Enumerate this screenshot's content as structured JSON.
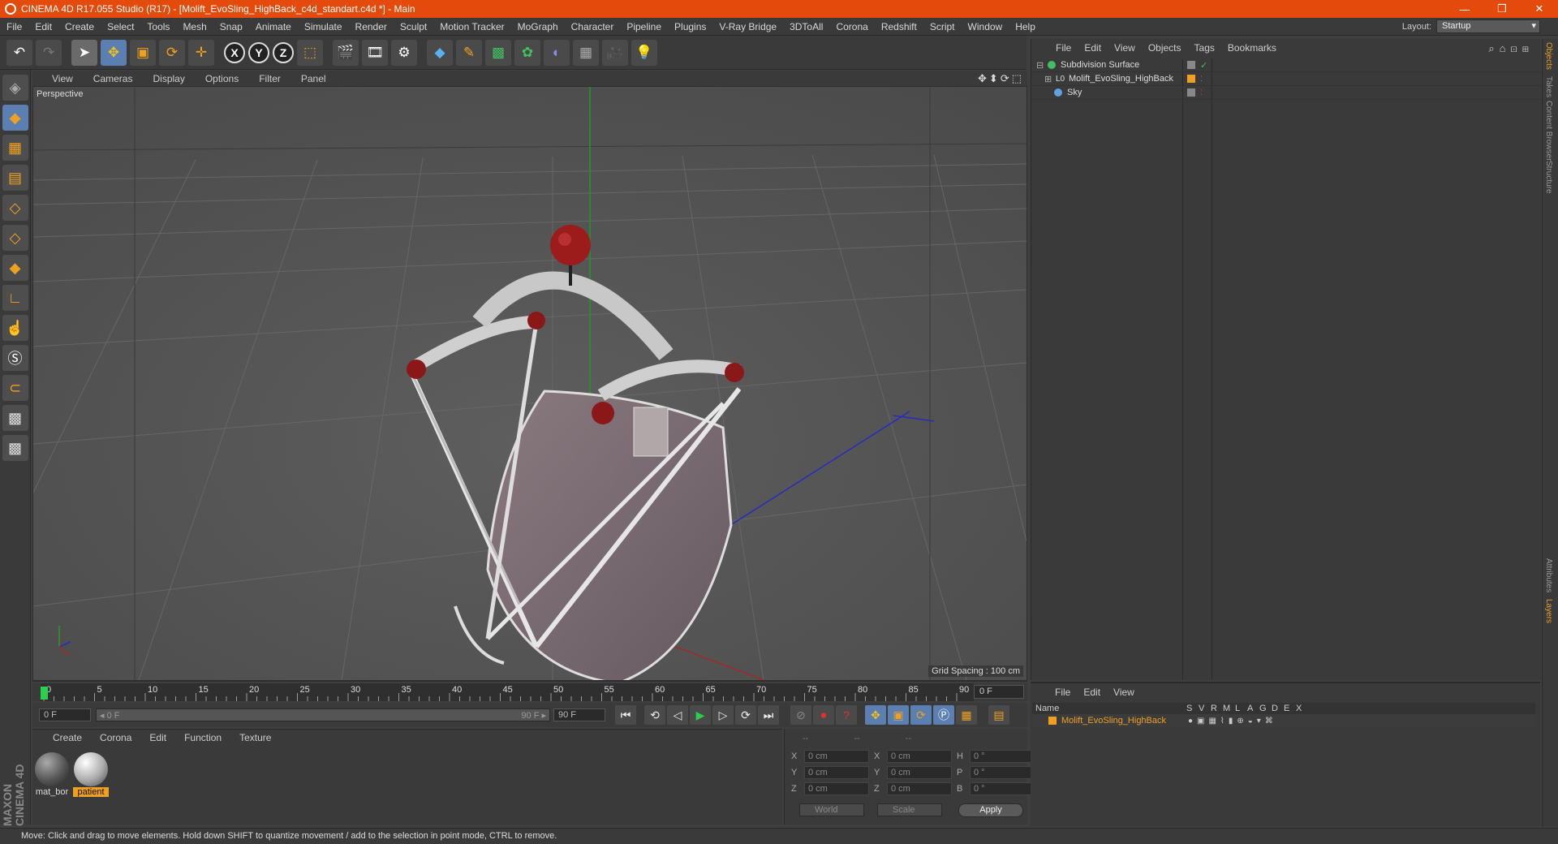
{
  "window": {
    "title": "CINEMA 4D R17.055 Studio (R17) - [Molift_EvoSling_HighBack_c4d_standart.c4d *] - Main",
    "minimize": "—",
    "maximize": "❐",
    "close": "✕"
  },
  "menu": [
    "File",
    "Edit",
    "Create",
    "Select",
    "Tools",
    "Mesh",
    "Snap",
    "Animate",
    "Simulate",
    "Render",
    "Sculpt",
    "Motion Tracker",
    "MoGraph",
    "Character",
    "Pipeline",
    "Plugins",
    "V-Ray Bridge",
    "3DToAll",
    "Corona",
    "Redshift",
    "Script",
    "Window",
    "Help"
  ],
  "layout": {
    "label": "Layout:",
    "value": "Startup"
  },
  "toolbar": {
    "undo": "↶",
    "redo": "↷",
    "select": "➤",
    "move": "✥",
    "scale": "▣",
    "rotate": "⟳",
    "transform": "✛",
    "x": "X",
    "y": "Y",
    "z": "Z",
    "coord": "⬚",
    "render_view": "🎬",
    "render": "🎞",
    "render_settings": "⚙",
    "cube": "◆",
    "pen": "✎",
    "subdivide": "▩",
    "mograph": "✿",
    "deformer": "◐",
    "floor": "▦",
    "camera": "🎥",
    "light": "💡"
  },
  "viewport": {
    "menu": [
      "View",
      "Cameras",
      "Display",
      "Options",
      "Filter",
      "Panel"
    ],
    "label": "Perspective",
    "grid_spacing": "Grid Spacing : 100 cm",
    "nav": "✥⬍⟳⬚"
  },
  "timeline": {
    "ticks": [
      "0",
      "5",
      "10",
      "15",
      "20",
      "25",
      "30",
      "35",
      "40",
      "45",
      "50",
      "55",
      "60",
      "65",
      "70",
      "75",
      "80",
      "85",
      "90"
    ],
    "current_frame": "0 F"
  },
  "transport": {
    "start": "0 F",
    "range_start": "◂ 0 F",
    "range_end": "90 F ▸",
    "end": "90 F"
  },
  "material_panel": {
    "menu": [
      "Create",
      "Corona",
      "Edit",
      "Function",
      "Texture"
    ],
    "materials": [
      {
        "name": "mat_bor",
        "color": "#6a6a6a"
      },
      {
        "name": "patient",
        "color": "#b0b0b0"
      }
    ]
  },
  "coordinates": {
    "headers": [
      "--",
      "--",
      "--"
    ],
    "rows": [
      {
        "a1": "X",
        "v1": "0 cm",
        "a2": "X",
        "v2": "0 cm",
        "a3": "H",
        "v3": "0 °"
      },
      {
        "a1": "Y",
        "v1": "0 cm",
        "a2": "Y",
        "v2": "0 cm",
        "a3": "P",
        "v3": "0 °"
      },
      {
        "a1": "Z",
        "v1": "0 cm",
        "a2": "Z",
        "v2": "0 cm",
        "a3": "B",
        "v3": "0 °"
      }
    ],
    "mode": "World",
    "scale": "Scale",
    "apply": "Apply"
  },
  "status": "Move: Click and drag to move elements. Hold down SHIFT to quantize movement / add to the selection in point mode, CTRL to remove.",
  "object_manager": {
    "menu": [
      "File",
      "Edit",
      "View",
      "Objects",
      "Tags",
      "Bookmarks"
    ],
    "objects": [
      {
        "name": "Subdivision Surface",
        "icon_color": "#40c060"
      },
      {
        "name": "Molift_EvoSling_HighBack",
        "icon_color": "#dddddd",
        "tag_color": "#f0a020"
      },
      {
        "name": "Sky",
        "icon_color": "#60a0e0"
      }
    ]
  },
  "layer_manager": {
    "menu": [
      "File",
      "Edit",
      "View"
    ],
    "columns": [
      "Name",
      "S",
      "V",
      "R",
      "M",
      "L",
      "A",
      "G",
      "D",
      "E",
      "X"
    ],
    "layers": [
      {
        "name": "Molift_EvoSling_HighBack",
        "color": "#f0a020"
      }
    ]
  },
  "right_tabs": [
    "Objects",
    "Takes",
    "Content Browser",
    "Structure",
    "Attributes",
    "Layers"
  ],
  "brand": "MAXON CINEMA 4D"
}
